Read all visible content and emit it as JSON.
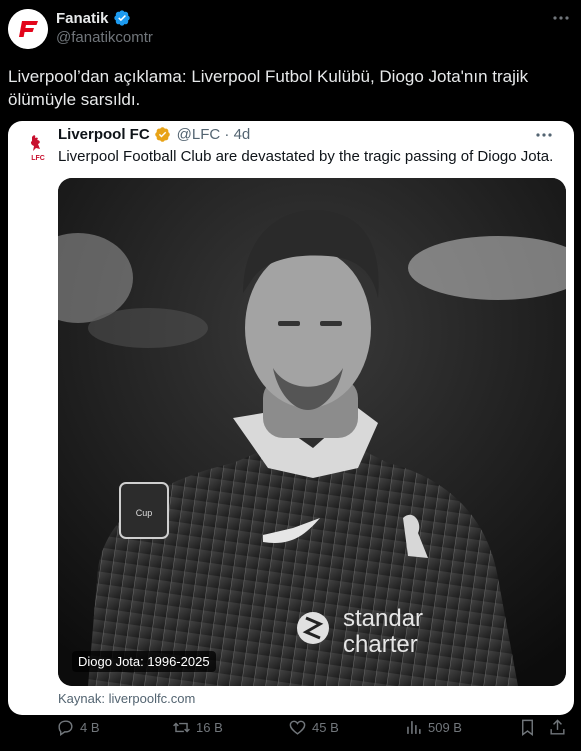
{
  "author": {
    "name": "Fanatik",
    "handle": "@fanatikcomtr",
    "verified": true,
    "logo_letter": "F",
    "logo_color": "#e3051b"
  },
  "post": {
    "text": "Liverpool’dan açıklama: Liverpool Futbol Kulübü, Diogo Jota'nın trajik ölümüyle sarsıldı."
  },
  "quoted": {
    "name": "Liverpool FC",
    "verified": true,
    "badge_color": "#e8a317",
    "handle": "@LFC · 4d",
    "text": "Liverpool Football Club are devastated by the tragic passing of Diogo Jota.",
    "image_caption": "Diogo Jota: 1996-2025",
    "source": "Kaynak: liverpoolfc.com"
  },
  "actions": {
    "replies": "4 B",
    "reposts": "16 B",
    "likes": "45 B",
    "views": "509 B"
  },
  "icons": [
    "verified-icon",
    "more-icon",
    "reply-icon",
    "repost-icon",
    "like-icon",
    "views-icon",
    "bookmark-icon",
    "share-icon"
  ],
  "colors": {
    "background": "#000000",
    "text": "#e7e9ea",
    "muted": "#71767b",
    "verified": "#1d9bf0"
  }
}
